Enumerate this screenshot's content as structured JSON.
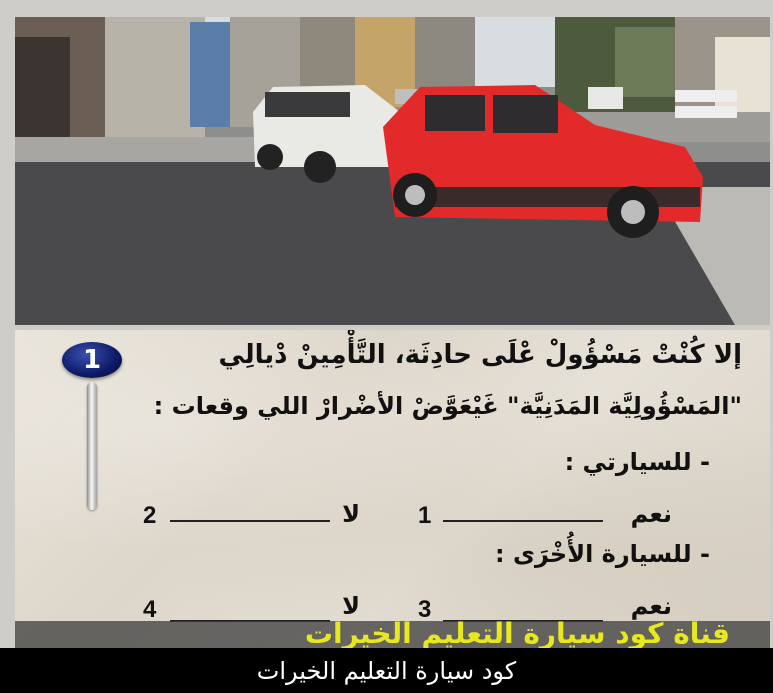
{
  "question": {
    "number": "1",
    "line1": "إلا كُنْتْ مَسْؤُولْ عْلَى حادِثَة، التَّأْمِينْ دْيالِي",
    "line2": "\"المَسْؤُولِيَّة المَدَنِيَّة\" غَيْعَوَّضْ الأضْرارْ اللي وقعات :",
    "section1": "- للسيارتي :",
    "section2": "- للسيارة الأُخْرَى :",
    "options": [
      {
        "label": "نعم",
        "number": "1"
      },
      {
        "label": "لا",
        "number": "2"
      },
      {
        "label": "نعم",
        "number": "3"
      },
      {
        "label": "لا",
        "number": "4"
      }
    ]
  },
  "photo": {
    "sign_text_1": "",
    "sign_text_2": ""
  },
  "ticker": {
    "text": "قناة كود سيارة التعليم الخيرات"
  },
  "caption": {
    "text": "كود سيارة التعليم الخيرات"
  }
}
